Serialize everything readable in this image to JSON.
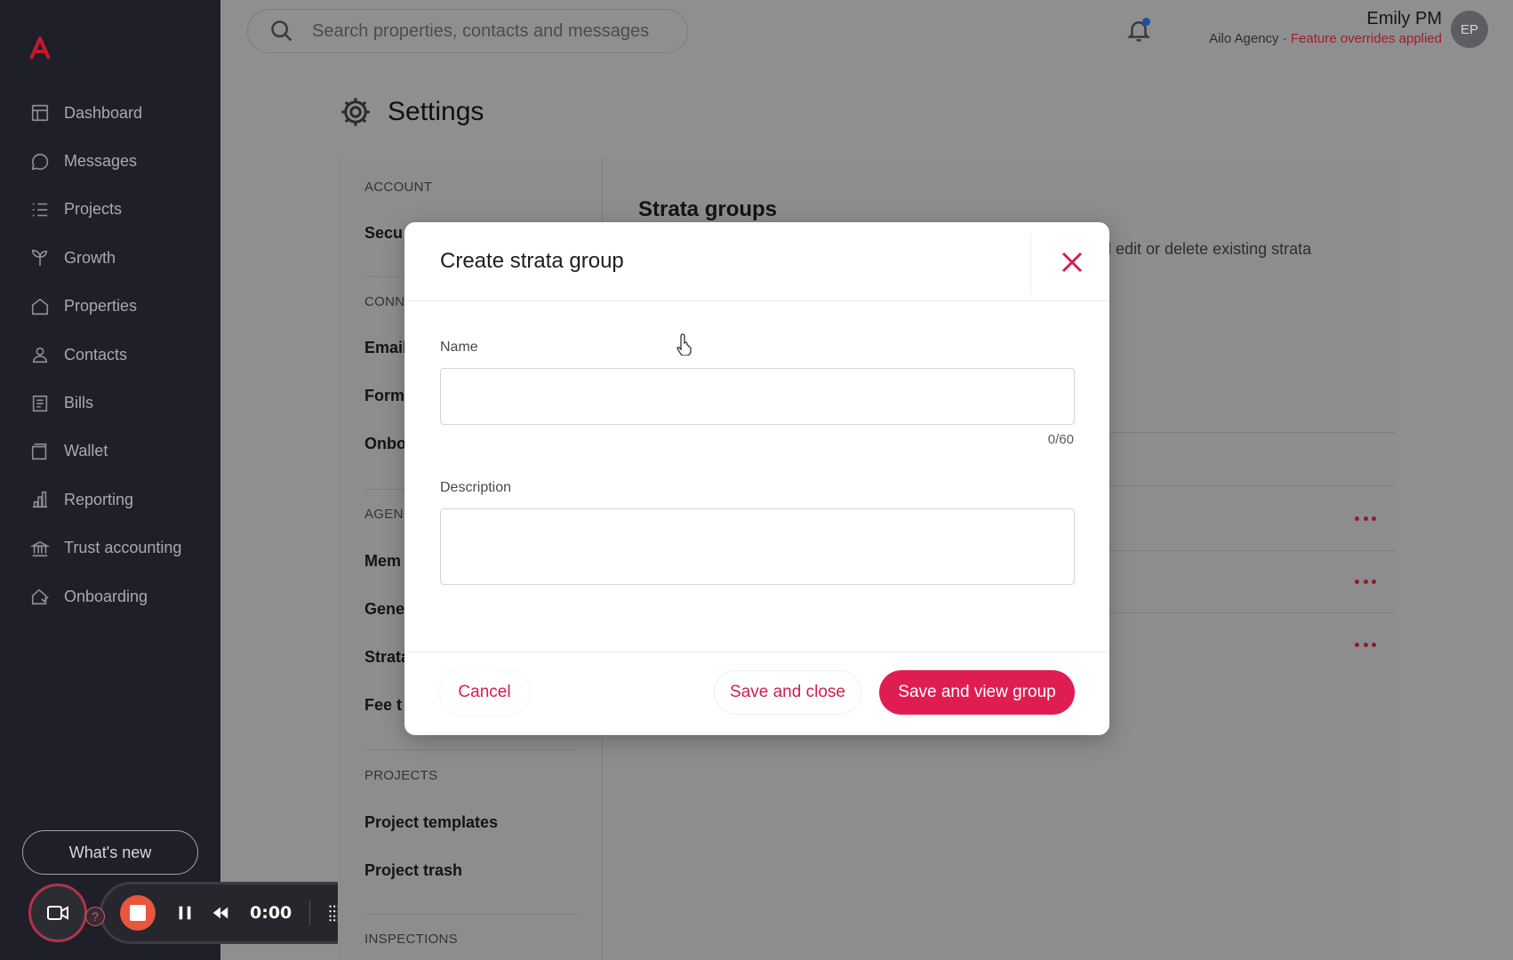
{
  "sidebar": {
    "logo_letter": "A",
    "items": [
      {
        "label": "Dashboard",
        "icon": "dashboard-icon"
      },
      {
        "label": "Messages",
        "icon": "message-icon"
      },
      {
        "label": "Projects",
        "icon": "list-icon"
      },
      {
        "label": "Growth",
        "icon": "sprout-icon"
      },
      {
        "label": "Properties",
        "icon": "house-icon"
      },
      {
        "label": "Contacts",
        "icon": "person-icon"
      },
      {
        "label": "Bills",
        "icon": "receipt-icon"
      },
      {
        "label": "Wallet",
        "icon": "wallet-icon"
      },
      {
        "label": "Reporting",
        "icon": "bar-chart-icon"
      },
      {
        "label": "Trust accounting",
        "icon": "bank-icon"
      },
      {
        "label": "Onboarding",
        "icon": "onboarding-icon"
      }
    ],
    "whats_new": "What's new"
  },
  "recorder": {
    "time": "0:00",
    "help_glyph": "?"
  },
  "header": {
    "search_placeholder": "Search properties, contacts and messages",
    "user_name": "Emily PM",
    "agency": "Ailo Agency",
    "separator": "·",
    "override_note": "Feature overrides applied",
    "avatar_initials": "EP"
  },
  "page": {
    "title": "Settings"
  },
  "settings_nav": {
    "sections": [
      {
        "label": "ACCOUNT",
        "items": [
          "Secu"
        ]
      },
      {
        "label": "CONN",
        "items": [
          "Email",
          "Form",
          "Onbo"
        ]
      },
      {
        "label": "AGEN",
        "items": [
          "Mem",
          "Gene",
          "Strata",
          "Fee t"
        ]
      },
      {
        "label": "PROJECTS",
        "items": [
          "Project templates",
          "Project trash"
        ]
      },
      {
        "label": "INSPECTIONS",
        "items": []
      }
    ]
  },
  "content": {
    "title": "Strata groups",
    "description_fragment": "d edit or delete existing strata"
  },
  "modal": {
    "title": "Create strata group",
    "name_label": "Name",
    "name_value": "",
    "name_counter": "0/60",
    "description_label": "Description",
    "description_value": "",
    "cancel": "Cancel",
    "save_close": "Save and close",
    "save_view": "Save and view group"
  },
  "colors": {
    "accent": "#e01d53",
    "sidebar_bg": "#1e1f29",
    "overlay_bg": "#8f8f8f"
  }
}
